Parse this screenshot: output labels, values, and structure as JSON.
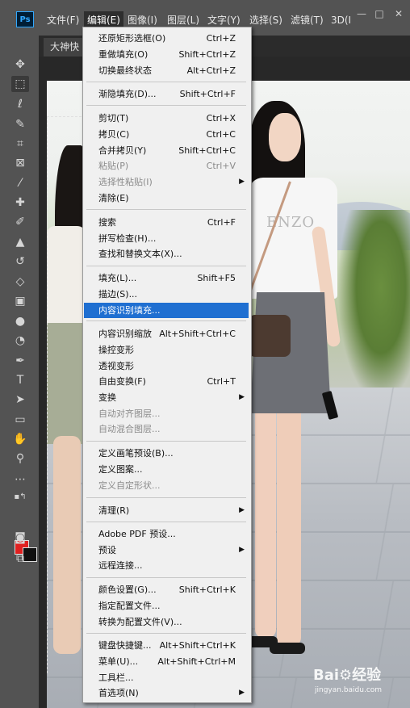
{
  "app": {
    "logo": "Ps"
  },
  "menubar": {
    "items": [
      {
        "label": "文件(F)"
      },
      {
        "label": "编辑(E)"
      },
      {
        "label": "图像(I)"
      },
      {
        "label": "图层(L)"
      },
      {
        "label": "文字(Y)"
      },
      {
        "label": "选择(S)"
      },
      {
        "label": "滤镜(T)"
      },
      {
        "label": "3D(I"
      }
    ],
    "window_controls": [
      "—",
      "□",
      "✕"
    ]
  },
  "document": {
    "tab_label": "大神快"
  },
  "toolbar": {
    "tools": [
      "move-icon",
      "marquee-icon",
      "lasso-icon",
      "quick-select-icon",
      "crop-icon",
      "frame-icon",
      "eyedropper-icon",
      "healing-icon",
      "brush-icon",
      "stamp-icon",
      "history-brush-icon",
      "eraser-icon",
      "gradient-icon",
      "blur-icon",
      "dodge-icon",
      "pen-icon",
      "type-icon",
      "path-select-icon",
      "rectangle-icon",
      "hand-icon",
      "zoom-icon",
      "more-icon"
    ],
    "foreground_color": "#e02020",
    "background_color": "#111111"
  },
  "canvas": {
    "shirt_text": "ENZO"
  },
  "edit_menu": {
    "items": [
      {
        "label": "还原矩形选框(O)",
        "shortcut": "Ctrl+Z"
      },
      {
        "label": "重做填充(O)",
        "shortcut": "Shift+Ctrl+Z"
      },
      {
        "label": "切换最终状态",
        "shortcut": "Alt+Ctrl+Z"
      },
      {
        "label": "渐隐填充(D)...",
        "shortcut": "Shift+Ctrl+F"
      },
      {
        "label": "剪切(T)",
        "shortcut": "Ctrl+X"
      },
      {
        "label": "拷贝(C)",
        "shortcut": "Ctrl+C"
      },
      {
        "label": "合并拷贝(Y)",
        "shortcut": "Shift+Ctrl+C"
      },
      {
        "label": "粘贴(P)",
        "shortcut": "Ctrl+V"
      },
      {
        "label": "选择性粘贴(I)",
        "shortcut": ""
      },
      {
        "label": "清除(E)",
        "shortcut": ""
      },
      {
        "label": "搜索",
        "shortcut": "Ctrl+F"
      },
      {
        "label": "拼写检查(H)...",
        "shortcut": ""
      },
      {
        "label": "查找和替换文本(X)...",
        "shortcut": ""
      },
      {
        "label": "填充(L)...",
        "shortcut": "Shift+F5"
      },
      {
        "label": "描边(S)...",
        "shortcut": ""
      },
      {
        "label": "内容识别填充...",
        "shortcut": ""
      },
      {
        "label": "内容识别缩放",
        "shortcut": "Alt+Shift+Ctrl+C"
      },
      {
        "label": "操控变形",
        "shortcut": ""
      },
      {
        "label": "透视变形",
        "shortcut": ""
      },
      {
        "label": "自由变换(F)",
        "shortcut": "Ctrl+T"
      },
      {
        "label": "变换",
        "shortcut": ""
      },
      {
        "label": "自动对齐图层...",
        "shortcut": ""
      },
      {
        "label": "自动混合图层...",
        "shortcut": ""
      },
      {
        "label": "定义画笔预设(B)...",
        "shortcut": ""
      },
      {
        "label": "定义图案...",
        "shortcut": ""
      },
      {
        "label": "定义自定形状...",
        "shortcut": ""
      },
      {
        "label": "清理(R)",
        "shortcut": ""
      },
      {
        "label": "Adobe PDF 预设...",
        "shortcut": ""
      },
      {
        "label": "预设",
        "shortcut": ""
      },
      {
        "label": "远程连接...",
        "shortcut": ""
      },
      {
        "label": "颜色设置(G)...",
        "shortcut": "Shift+Ctrl+K"
      },
      {
        "label": "指定配置文件...",
        "shortcut": ""
      },
      {
        "label": "转换为配置文件(V)...",
        "shortcut": ""
      },
      {
        "label": "键盘快捷键...",
        "shortcut": "Alt+Shift+Ctrl+K"
      },
      {
        "label": "菜单(U)...",
        "shortcut": "Alt+Shift+Ctrl+M"
      },
      {
        "label": "工具栏...",
        "shortcut": ""
      },
      {
        "label": "首选项(N)",
        "shortcut": ""
      }
    ]
  },
  "watermark": {
    "logo": "Bai⚙经验",
    "sub": "jingyan.baidu.com"
  }
}
